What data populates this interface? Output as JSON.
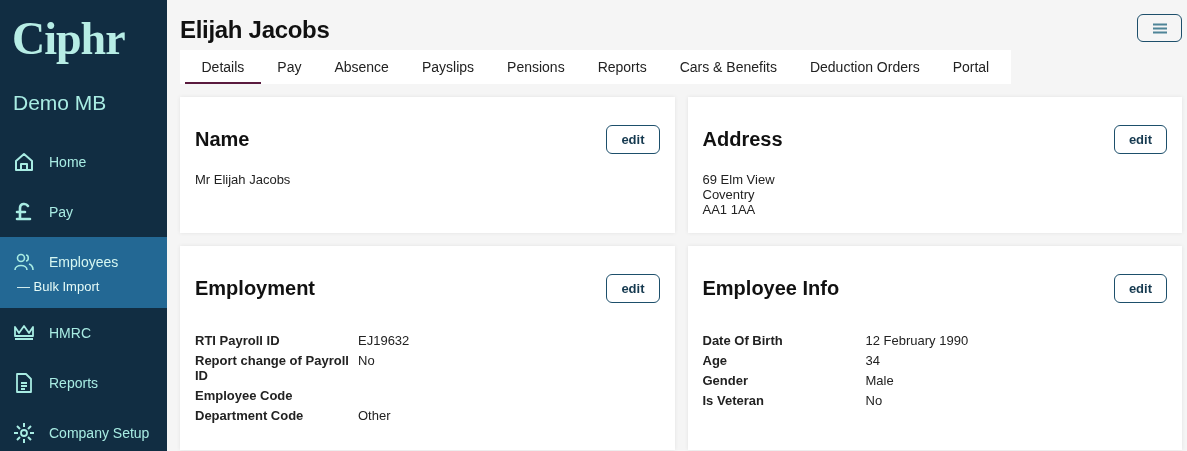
{
  "sidebar": {
    "logo": "Ciphr",
    "company": "Demo MB",
    "items": [
      {
        "label": "Home",
        "selected": false
      },
      {
        "label": "Pay",
        "selected": false
      },
      {
        "label": "Employees",
        "selected": true,
        "children": [
          {
            "label": "— Bulk Import"
          }
        ]
      },
      {
        "label": "HMRC",
        "selected": false
      },
      {
        "label": "Reports",
        "selected": false
      },
      {
        "label": "Company Setup",
        "selected": false
      }
    ]
  },
  "header": {
    "title": "Elijah Jacobs"
  },
  "tabs": [
    {
      "label": "Details",
      "selected": true
    },
    {
      "label": "Pay",
      "selected": false
    },
    {
      "label": "Absence",
      "selected": false
    },
    {
      "label": "Payslips",
      "selected": false
    },
    {
      "label": "Pensions",
      "selected": false
    },
    {
      "label": "Reports",
      "selected": false
    },
    {
      "label": "Cars & Benefits",
      "selected": false
    },
    {
      "label": "Deduction Orders",
      "selected": false
    },
    {
      "label": "Portal",
      "selected": false
    }
  ],
  "cards": [
    {
      "kind": "lines",
      "title": "Name",
      "button": "edit",
      "lines": [
        "Mr Elijah Jacobs"
      ]
    },
    {
      "kind": "lines",
      "title": "Address",
      "button": "edit",
      "lines": [
        "69 Elm View",
        "Coventry",
        "AA1 1AA"
      ]
    },
    {
      "kind": "fields",
      "title": "Employment",
      "button": "edit",
      "fields": [
        {
          "label": "RTI Payroll ID",
          "value": "EJ19632"
        },
        {
          "label": "Report change of Payroll ID",
          "value": "No"
        },
        {
          "label": "Employee Code"
        },
        {
          "label": "Department Code",
          "value": "Other"
        }
      ]
    },
    {
      "kind": "fields",
      "title": "Employee Info",
      "button": "edit",
      "fields": [
        {
          "label": "Date Of Birth",
          "value": "12 February 1990"
        },
        {
          "label": "Age",
          "value": "34"
        },
        {
          "label": "Gender",
          "value": "Male"
        },
        {
          "label": "Is Veteran",
          "value": "No"
        }
      ]
    }
  ]
}
